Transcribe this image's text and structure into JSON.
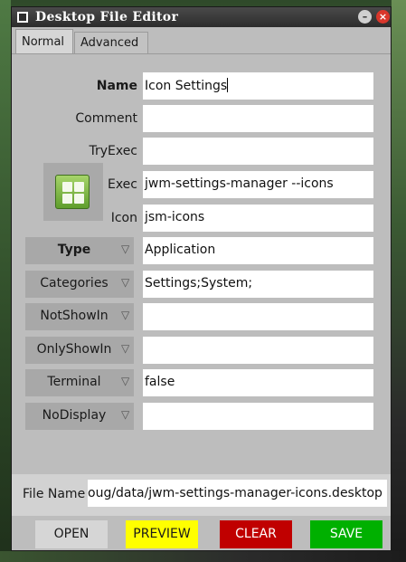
{
  "window": {
    "title": "Desktop File Editor"
  },
  "tabs": [
    {
      "label": "Normal"
    },
    {
      "label": "Advanced"
    }
  ],
  "fields": {
    "name": {
      "label": "Name",
      "value": "Icon Settings"
    },
    "comment": {
      "label": "Comment",
      "value": ""
    },
    "tryexec": {
      "label": "TryExec",
      "value": ""
    },
    "exec": {
      "label": "Exec",
      "value": "jwm-settings-manager --icons"
    },
    "icon": {
      "label": "Icon",
      "value": "jsm-icons"
    }
  },
  "dropdowns": [
    {
      "label": "Type",
      "value": "Application"
    },
    {
      "label": "Categories",
      "value": "Settings;System;"
    },
    {
      "label": "NotShowIn",
      "value": ""
    },
    {
      "label": "OnlyShowIn",
      "value": ""
    },
    {
      "label": "Terminal",
      "value": "false"
    },
    {
      "label": "NoDisplay",
      "value": ""
    }
  ],
  "file_name": {
    "label": "File Name",
    "value": "oug/data/jwm-settings-manager-icons.desktop"
  },
  "buttons": {
    "open": "OPEN",
    "preview": "PREVIEW",
    "clear": "CLEAR",
    "save": "SAVE"
  },
  "colors": {
    "preview": "#ffff00",
    "clear": "#c00000",
    "save": "#00b000"
  },
  "icons": {
    "app_icon": "jsm-icons-grid-icon",
    "dropdown_arrow": "triangle-down-icon"
  }
}
